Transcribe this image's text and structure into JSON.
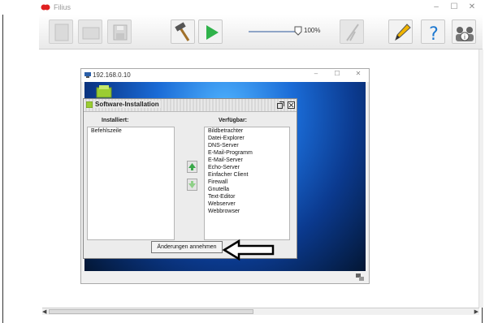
{
  "app": {
    "title": "Filius"
  },
  "window_controls": {
    "minimize": "–",
    "maximize": "☐",
    "close": "✕"
  },
  "toolbar": {
    "zoom_label": "100%"
  },
  "pc_window": {
    "title": "192.168.0.10",
    "controls": {
      "minimize": "–",
      "maximize": "☐",
      "close": "✕"
    }
  },
  "dialog": {
    "title": "Software-Installation",
    "installed_header": "Installiert:",
    "available_header": "Verfügbar:",
    "installed_items": [
      "Befehlszeile"
    ],
    "available_items": [
      "Bildbetrachter",
      "Datei-Explorer",
      "DNS-Server",
      "E-Mail-Programm",
      "E-Mail-Server",
      "Echo-Server",
      "Einfacher Client",
      "Firewall",
      "Gnutella",
      "Text-Editor",
      "Webserver",
      "Webbrowser"
    ],
    "apply_button": "Änderungen annehmen"
  },
  "colors": {
    "desktop_center": "#4fb3ff",
    "desktop_edge": "#031633",
    "play_green": "#2fb24a",
    "annotation_arrow": "#000000"
  },
  "icons": [
    "new-icon",
    "open-icon",
    "save-icon",
    "hammer-icon",
    "play-icon",
    "wireless-icon",
    "pencil-icon",
    "help-icon",
    "info-icon",
    "arrow-icon"
  ]
}
